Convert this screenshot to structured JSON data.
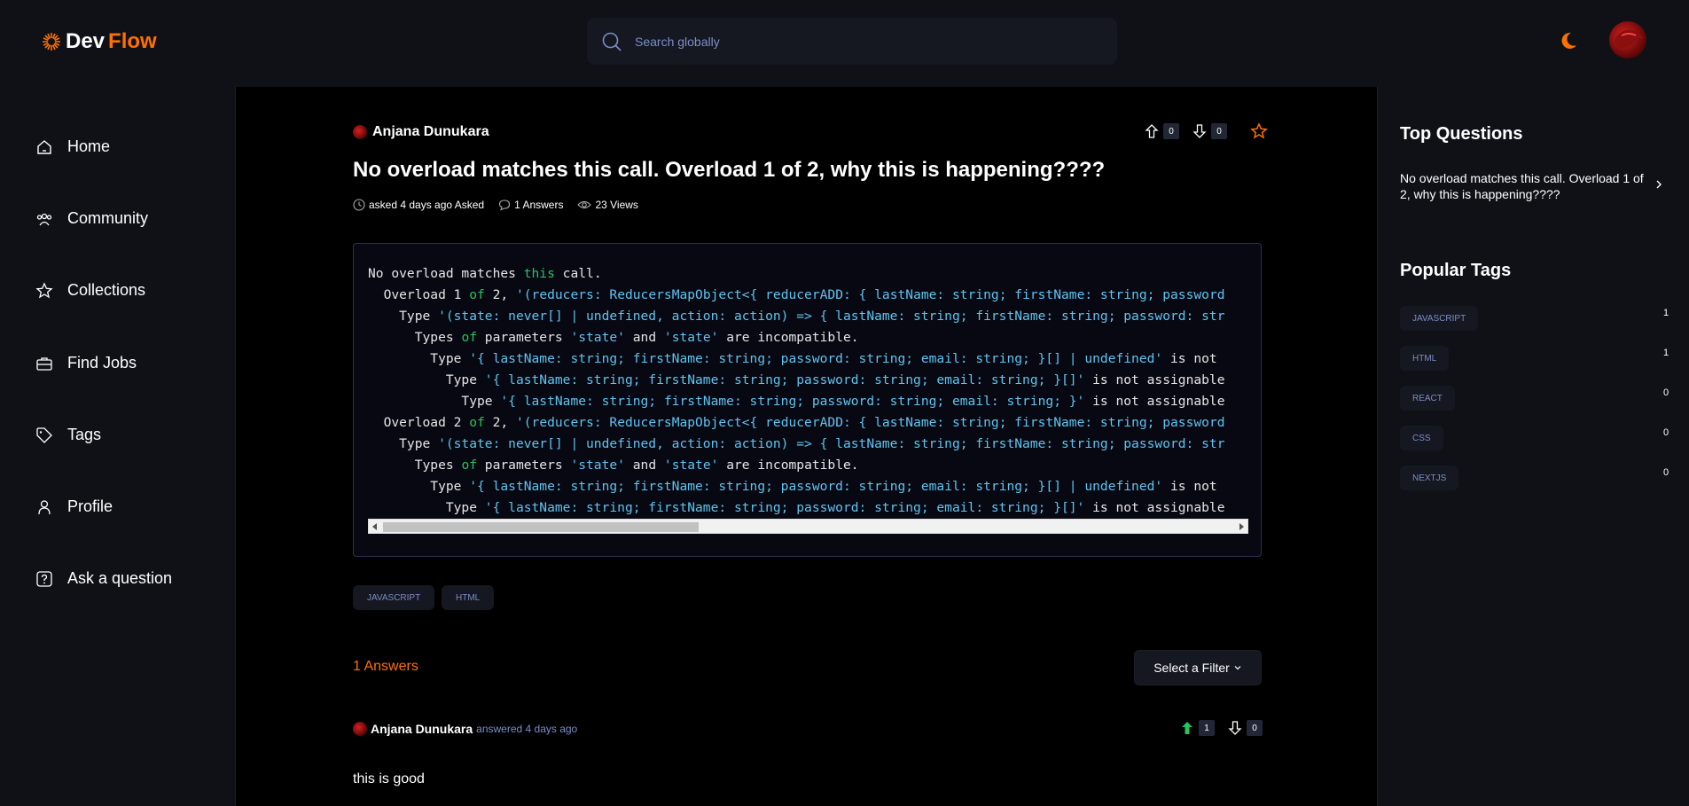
{
  "header": {
    "logo_part1": "Dev",
    "logo_part2": "Flow",
    "search_placeholder": "Search globally",
    "theme_icon": "moon-icon"
  },
  "sidebar": {
    "items": [
      {
        "label": "Home",
        "icon": "home-icon"
      },
      {
        "label": "Community",
        "icon": "users-icon"
      },
      {
        "label": "Collections",
        "icon": "star-icon"
      },
      {
        "label": "Find Jobs",
        "icon": "briefcase-icon"
      },
      {
        "label": "Tags",
        "icon": "tag-icon"
      },
      {
        "label": "Profile",
        "icon": "user-icon"
      },
      {
        "label": "Ask a question",
        "icon": "question-icon"
      }
    ]
  },
  "question": {
    "author": "Anjana Dunukara",
    "upvotes": "0",
    "downvotes": "0",
    "title": "No overload matches this call. Overload 1 of 2, why this is happening????",
    "asked": "asked 4 days ago Asked",
    "answers": "1 Answers",
    "views": "23 Views",
    "code_lines": [
      "No overload matches this call.",
      "  Overload 1 of 2, '(reducers: ReducersMapObject<{ reducerADD: { lastName: string; firstName: string; password",
      "    Type '(state: never[] | undefined, action: action) => { lastName: string; firstName: string; password: str",
      "      Types of parameters 'state' and 'state' are incompatible.",
      "        Type '{ lastName: string; firstName: string; password: string; email: string; }[] | undefined' is not",
      "          Type '{ lastName: string; firstName: string; password: string; email: string; }[]' is not assignable",
      "            Type '{ lastName: string; firstName: string; password: string; email: string; }' is not assignable",
      "  Overload 2 of 2, '(reducers: ReducersMapObject<{ reducerADD: { lastName: string; firstName: string; password",
      "    Type '(state: never[] | undefined, action: action) => { lastName: string; firstName: string; password: str",
      "      Types of parameters 'state' and 'state' are incompatible.",
      "        Type '{ lastName: string; firstName: string; password: string; email: string; }[] | undefined' is not",
      "          Type '{ lastName: string; firstName: string; password: string; email: string; }[]' is not assignable"
    ],
    "tags": [
      "JAVASCRIPT",
      "HTML"
    ]
  },
  "answers_section": {
    "count_label": "1 Answers",
    "filter_label": "Select a Filter",
    "answer": {
      "author": "Anjana Dunukara",
      "when": "answered 4 days ago",
      "upvotes": "1",
      "downvotes": "0",
      "body": "this is good"
    }
  },
  "rightbar": {
    "top_questions_title": "Top Questions",
    "top_question": "No overload matches this call. Overload 1 of 2, why this is happening????",
    "popular_tags_title": "Popular Tags",
    "tags": [
      {
        "name": "JAVASCRIPT",
        "count": "1"
      },
      {
        "name": "HTML",
        "count": "1"
      },
      {
        "name": "REACT",
        "count": "0"
      },
      {
        "name": "CSS",
        "count": "0"
      },
      {
        "name": "NEXTJS",
        "count": "0"
      }
    ]
  },
  "colors": {
    "accent": "#ff7000",
    "tag_text": "#7b8ec8",
    "upvote_active": "#22c55e"
  }
}
